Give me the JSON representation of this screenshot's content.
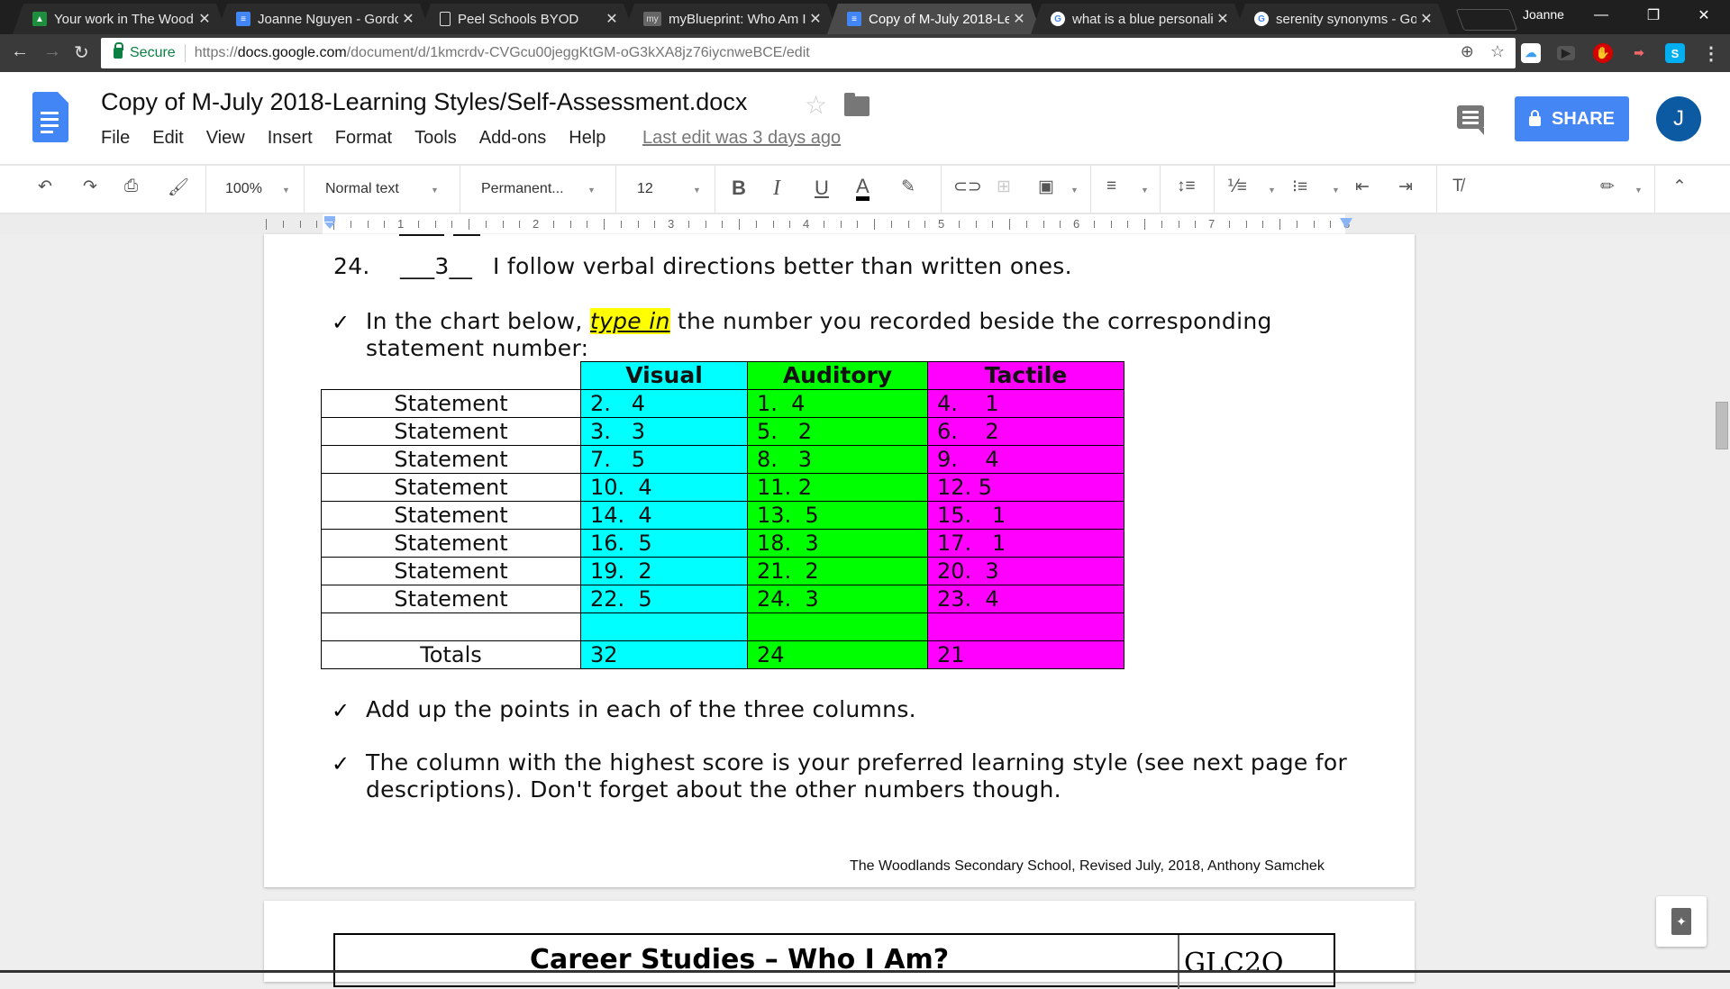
{
  "browser": {
    "tabs": [
      {
        "title": "Your work in The Wood",
        "icon": "classroom-icon",
        "active": false
      },
      {
        "title": "Joanne Nguyen - Gordo",
        "icon": "docs-icon",
        "active": false
      },
      {
        "title": "Peel Schools BYOD",
        "icon": "page-icon",
        "active": false
      },
      {
        "title": "myBlueprint: Who Am I",
        "icon": "myblueprint-icon",
        "active": false
      },
      {
        "title": "Copy of M-July 2018-Le",
        "icon": "docs-icon",
        "active": true
      },
      {
        "title": "what is a blue personali",
        "icon": "google-icon",
        "active": false
      },
      {
        "title": "serenity synonyms - Go",
        "icon": "google-icon",
        "active": false
      }
    ],
    "profile_name": "Joanne",
    "address": {
      "secure_label": "Secure",
      "url_scheme": "https://",
      "url_host": "docs.google.com",
      "url_path": "/document/d/1kmcrdv-CVGcu00jeggKtGM-oG3kXA8jz76iycnweBCE/edit"
    }
  },
  "docs": {
    "title": "Copy of M-July 2018-Learning Styles/Self-Assessment.docx",
    "menu": [
      "File",
      "Edit",
      "View",
      "Insert",
      "Format",
      "Tools",
      "Add-ons",
      "Help"
    ],
    "last_edit": "Last edit was 3 days ago",
    "share_label": "SHARE",
    "avatar_initial": "J",
    "toolbar": {
      "zoom": "100%",
      "style": "Normal text",
      "font": "Permanent...",
      "size": "12",
      "bold": "B",
      "italic": "I",
      "underline": "U",
      "text_color": "A"
    },
    "ruler_numbers": [
      "1",
      "2",
      "3",
      "4",
      "5",
      "6",
      "7",
      "8"
    ]
  },
  "document": {
    "item24": {
      "number": "24.",
      "answer": "___3__",
      "text": "I follow verbal directions better than written ones."
    },
    "check_mark": "✓",
    "instruction1": {
      "before": "In the chart below, ",
      "highlight": "type in",
      "after": " the number you recorded beside the corresponding",
      "line2": "statement number:"
    },
    "table": {
      "headers": [
        "Visual",
        "Auditory",
        "Tactile"
      ],
      "colors": {
        "visual": "#00ffff",
        "auditory": "#00ff00",
        "tactile": "#ff00ff"
      },
      "rows": [
        {
          "label": "Statement",
          "visual": "2.   4",
          "auditory": "1.  4",
          "tactile": "4.    1"
        },
        {
          "label": "Statement",
          "visual": "3.   3",
          "auditory": "5.   2",
          "tactile": "6.    2"
        },
        {
          "label": "Statement",
          "visual": "7.   5",
          "auditory": "8.   3",
          "tactile": "9.    4"
        },
        {
          "label": "Statement",
          "visual": "10.  4",
          "auditory": "11. 2",
          "tactile": "12. 5"
        },
        {
          "label": "Statement",
          "visual": "14.  4",
          "auditory": "13.  5",
          "tactile": "15.   1"
        },
        {
          "label": "Statement",
          "visual": "16.  5",
          "auditory": "18.  3",
          "tactile": "17.   1"
        },
        {
          "label": "Statement",
          "visual": "19.  2",
          "auditory": "21.  2",
          "tactile": "20.  3"
        },
        {
          "label": "Statement",
          "visual": "22.  5",
          "auditory": "24.  3",
          "tactile": "23.  4"
        },
        {
          "label": "",
          "visual": "",
          "auditory": "",
          "tactile": ""
        }
      ],
      "totals": {
        "label": "Totals",
        "visual": "32",
        "auditory": "24",
        "tactile": "21"
      }
    },
    "instruction2": "Add up the points in each of the three columns.",
    "instruction3": {
      "line1": "The column with the highest score is your preferred learning style (see next page for",
      "line2": "descriptions).  Don't forget about the other numbers though."
    },
    "footer": "The Woodlands Secondary School, Revised July, 2018, Anthony Samchek",
    "page2": {
      "title": "Career Studies – Who I Am?",
      "course_code": "GLC2O"
    }
  }
}
